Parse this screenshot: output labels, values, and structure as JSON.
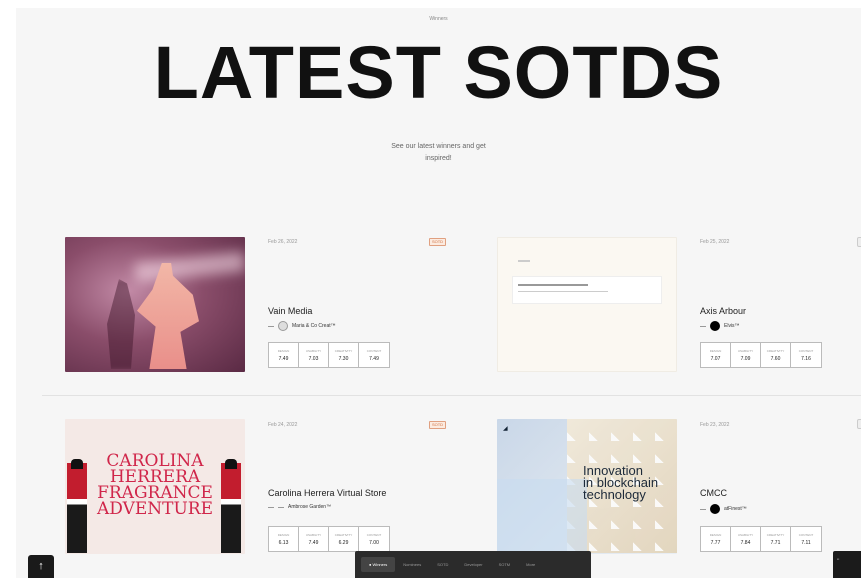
{
  "header": {
    "top_label": "Winners",
    "title": "LATEST SOTDS",
    "subtitle_line1": "See our latest winners and get",
    "subtitle_line2": "inspired!"
  },
  "score_keys": [
    "Design",
    "Usability",
    "Creativity",
    "Content"
  ],
  "cards": [
    {
      "date": "Feb 26, 2022",
      "tag": "SOTD",
      "title": "Vain Media",
      "author": "Maria & Co Creat™",
      "scores": [
        "7.49",
        "7.03",
        "7.30",
        "7.49"
      ]
    },
    {
      "date": "Feb 25, 2022",
      "title": "Axis Arbour",
      "author": "Elvis™",
      "scores": [
        "7.07",
        "7.09",
        "7.60",
        "7.16"
      ]
    },
    {
      "date": "Feb 24, 2022",
      "tag": "SOTD",
      "title": "Carolina Herrera Virtual Store",
      "author": "Ambrose Garden™",
      "scores": [
        "6.13",
        "7.49",
        "6.29",
        "7.00"
      ]
    },
    {
      "date": "Feb 23, 2022",
      "title": "CMCC",
      "author": "atFinest™",
      "scores": [
        "7.77",
        "7.84",
        "7.71",
        "7.11"
      ]
    }
  ],
  "thumbs": {
    "carolina_line1": "CAROLINA",
    "carolina_line2": "HERRERA",
    "carolina_line3": "FRAGRANCE",
    "carolina_line4": "ADVENTURE",
    "cmcc_line1": "Innovation",
    "cmcc_line2": "in blockchain",
    "cmcc_line3": "technology"
  },
  "bottom_bar": {
    "items": [
      "● Winners",
      "Nominees",
      "SOTD",
      "Developer",
      "SOTM",
      "More"
    ]
  },
  "up_button": "↑"
}
